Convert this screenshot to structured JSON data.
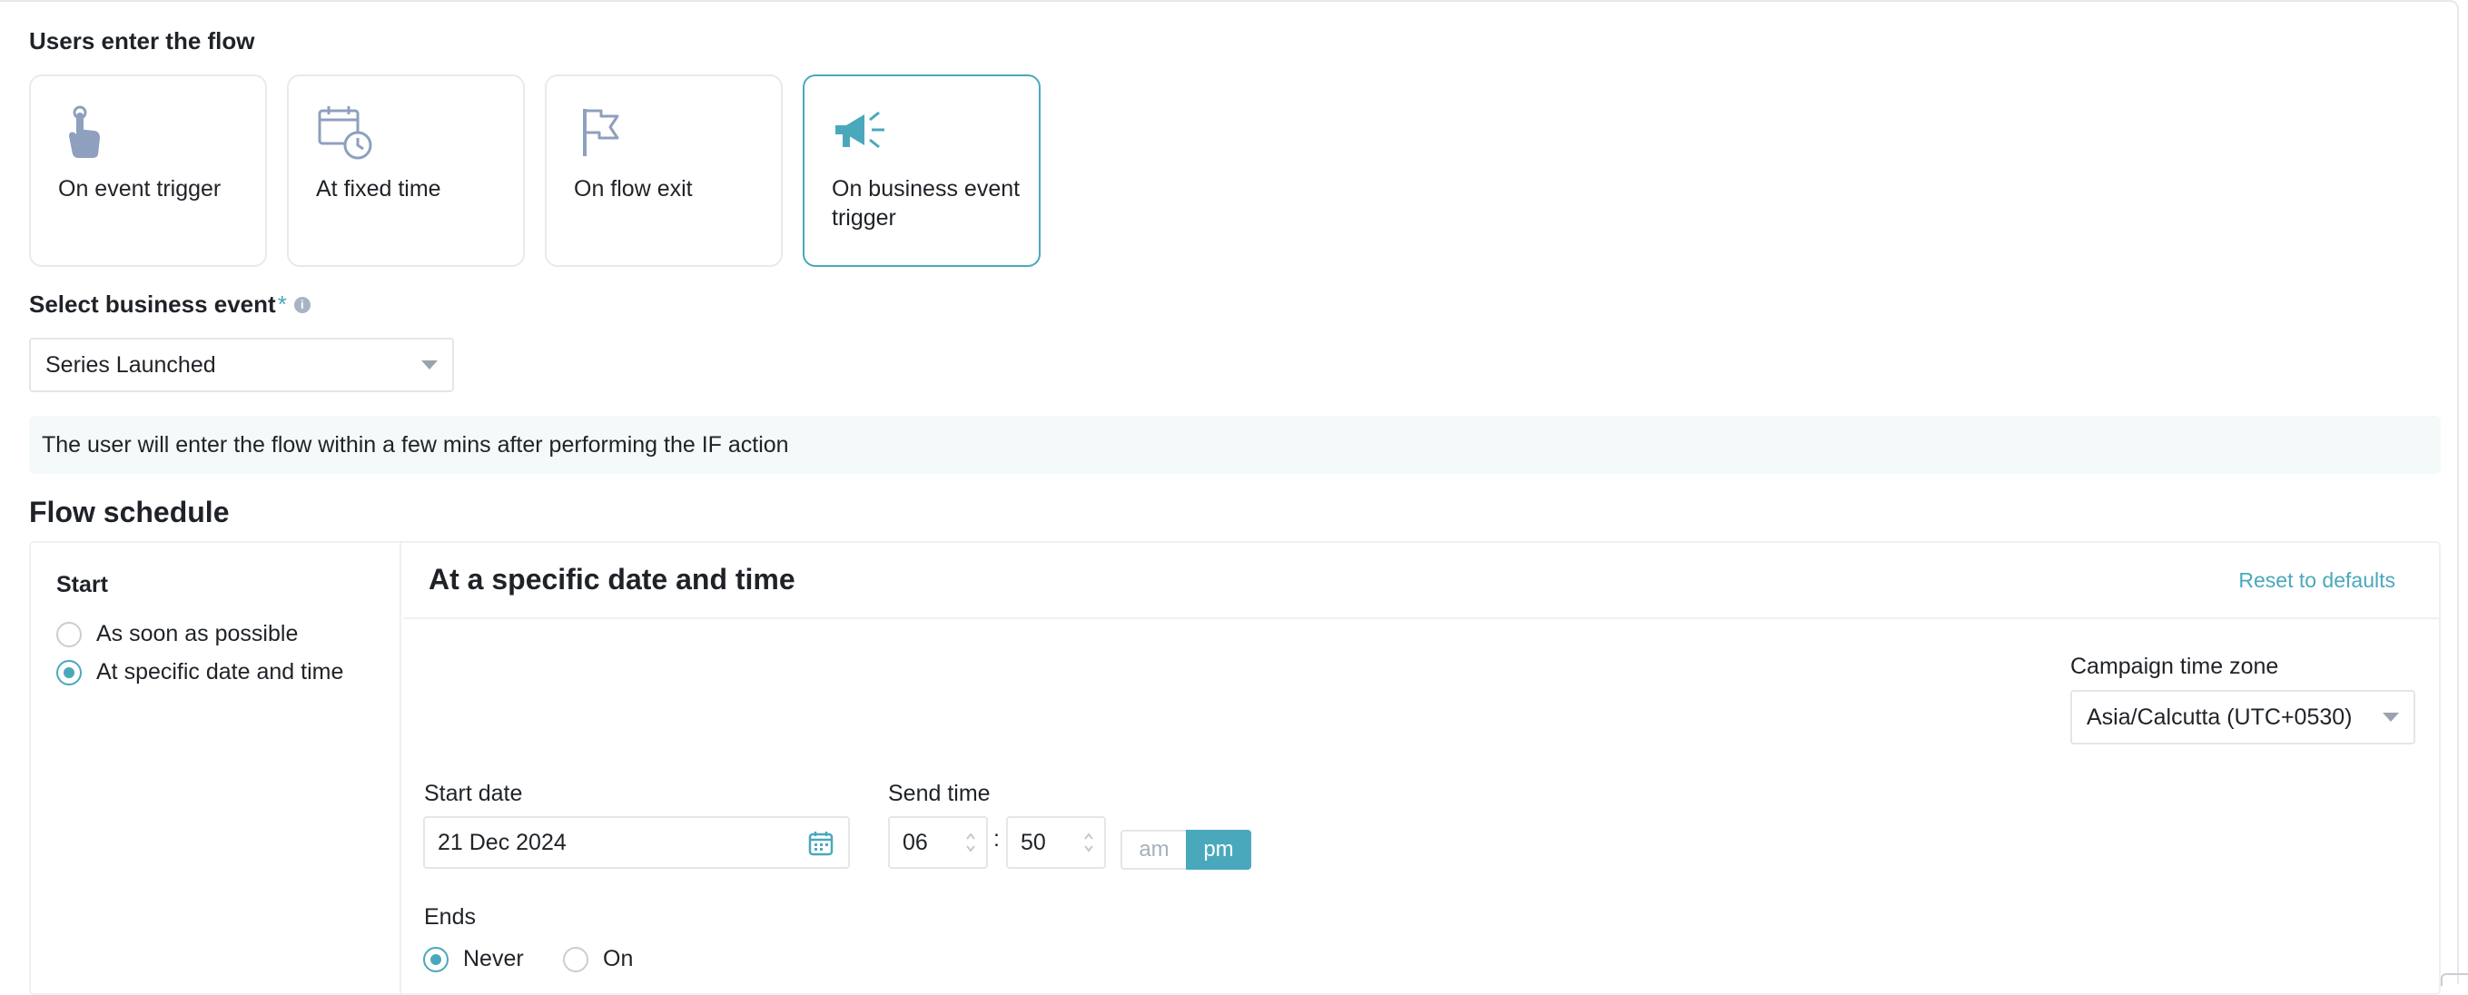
{
  "entry": {
    "section_label": "Users enter the flow",
    "options": [
      {
        "label": "On event trigger",
        "icon": "hand-tap-icon",
        "selected": false
      },
      {
        "label": "At fixed time",
        "icon": "calendar-clock-icon",
        "selected": false
      },
      {
        "label": "On flow exit",
        "icon": "flag-icon",
        "selected": false
      },
      {
        "label": "On business event trigger",
        "icon": "megaphone-icon",
        "selected": true
      }
    ]
  },
  "business_event": {
    "label": "Select business event",
    "required_mark": "*",
    "selected_value": "Series Launched"
  },
  "note": "The user will enter the flow within a few mins after performing the IF action",
  "schedule": {
    "title": "Flow schedule",
    "start": {
      "title": "Start",
      "options": [
        {
          "label": "As soon as possible",
          "checked": false
        },
        {
          "label": "At specific date and time",
          "checked": true
        }
      ]
    },
    "panel": {
      "title": "At a specific date and time",
      "reset_label": "Reset to defaults",
      "timezone_label": "Campaign time zone",
      "timezone_value": "Asia/Calcutta (UTC+0530)",
      "start_date_label": "Start date",
      "start_date_value": "21 Dec 2024",
      "send_time_label": "Send time",
      "hour": "06",
      "minute": "50",
      "separator": ":",
      "am_label": "am",
      "pm_label": "pm",
      "selected_period": "pm",
      "ends_label": "Ends",
      "ends_options": [
        {
          "label": "Never",
          "checked": true
        },
        {
          "label": "On",
          "checked": false
        }
      ]
    }
  },
  "colors": {
    "accent": "#4aa8bd",
    "icon": "#8ea0bd",
    "border": "#e3e6ea"
  }
}
